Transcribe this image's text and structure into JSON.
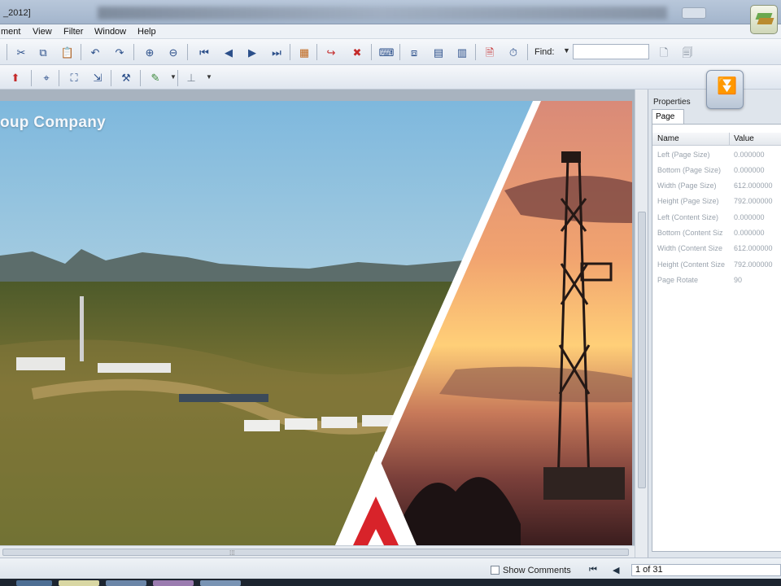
{
  "window": {
    "title_fragment": "_2012]"
  },
  "menu": {
    "items": [
      "ment",
      "View",
      "Filter",
      "Window",
      "Help"
    ]
  },
  "toolbar": {
    "find_label": "Find:",
    "find_value": ""
  },
  "document": {
    "banner_text": "oup Company"
  },
  "panel": {
    "title": "Properties",
    "tab": "Page",
    "col_name": "Name",
    "col_value": "Value",
    "rows": [
      {
        "name": "Left (Page Size)",
        "value": "0.000000"
      },
      {
        "name": "Bottom (Page Size)",
        "value": "0.000000"
      },
      {
        "name": "Width (Page Size)",
        "value": "612.000000"
      },
      {
        "name": "Height (Page Size)",
        "value": "792.000000"
      },
      {
        "name": "Left (Content Size)",
        "value": "0.000000"
      },
      {
        "name": "Bottom (Content Siz",
        "value": "0.000000"
      },
      {
        "name": "Width (Content Size",
        "value": "612.000000"
      },
      {
        "name": "Height (Content Size",
        "value": "792.000000"
      },
      {
        "name": "Page Rotate",
        "value": "90"
      }
    ]
  },
  "status": {
    "show_comments": "Show Comments",
    "page_count": "1 of 31"
  },
  "icons": {
    "cut": "scissors-icon",
    "copy": "copy-icon",
    "paste": "paste-icon",
    "undo": "undo-icon",
    "redo": "redo-icon",
    "zoom_in": "zoom-in-icon",
    "zoom_out": "zoom-out-icon",
    "first": "first-page-icon",
    "prev": "prev-page-icon",
    "next": "next-page-icon",
    "last": "last-page-icon"
  },
  "colors": {
    "accent": "#2b4f8a",
    "panel_bg": "#dfe5ec",
    "logo_red": "#d8232a"
  }
}
